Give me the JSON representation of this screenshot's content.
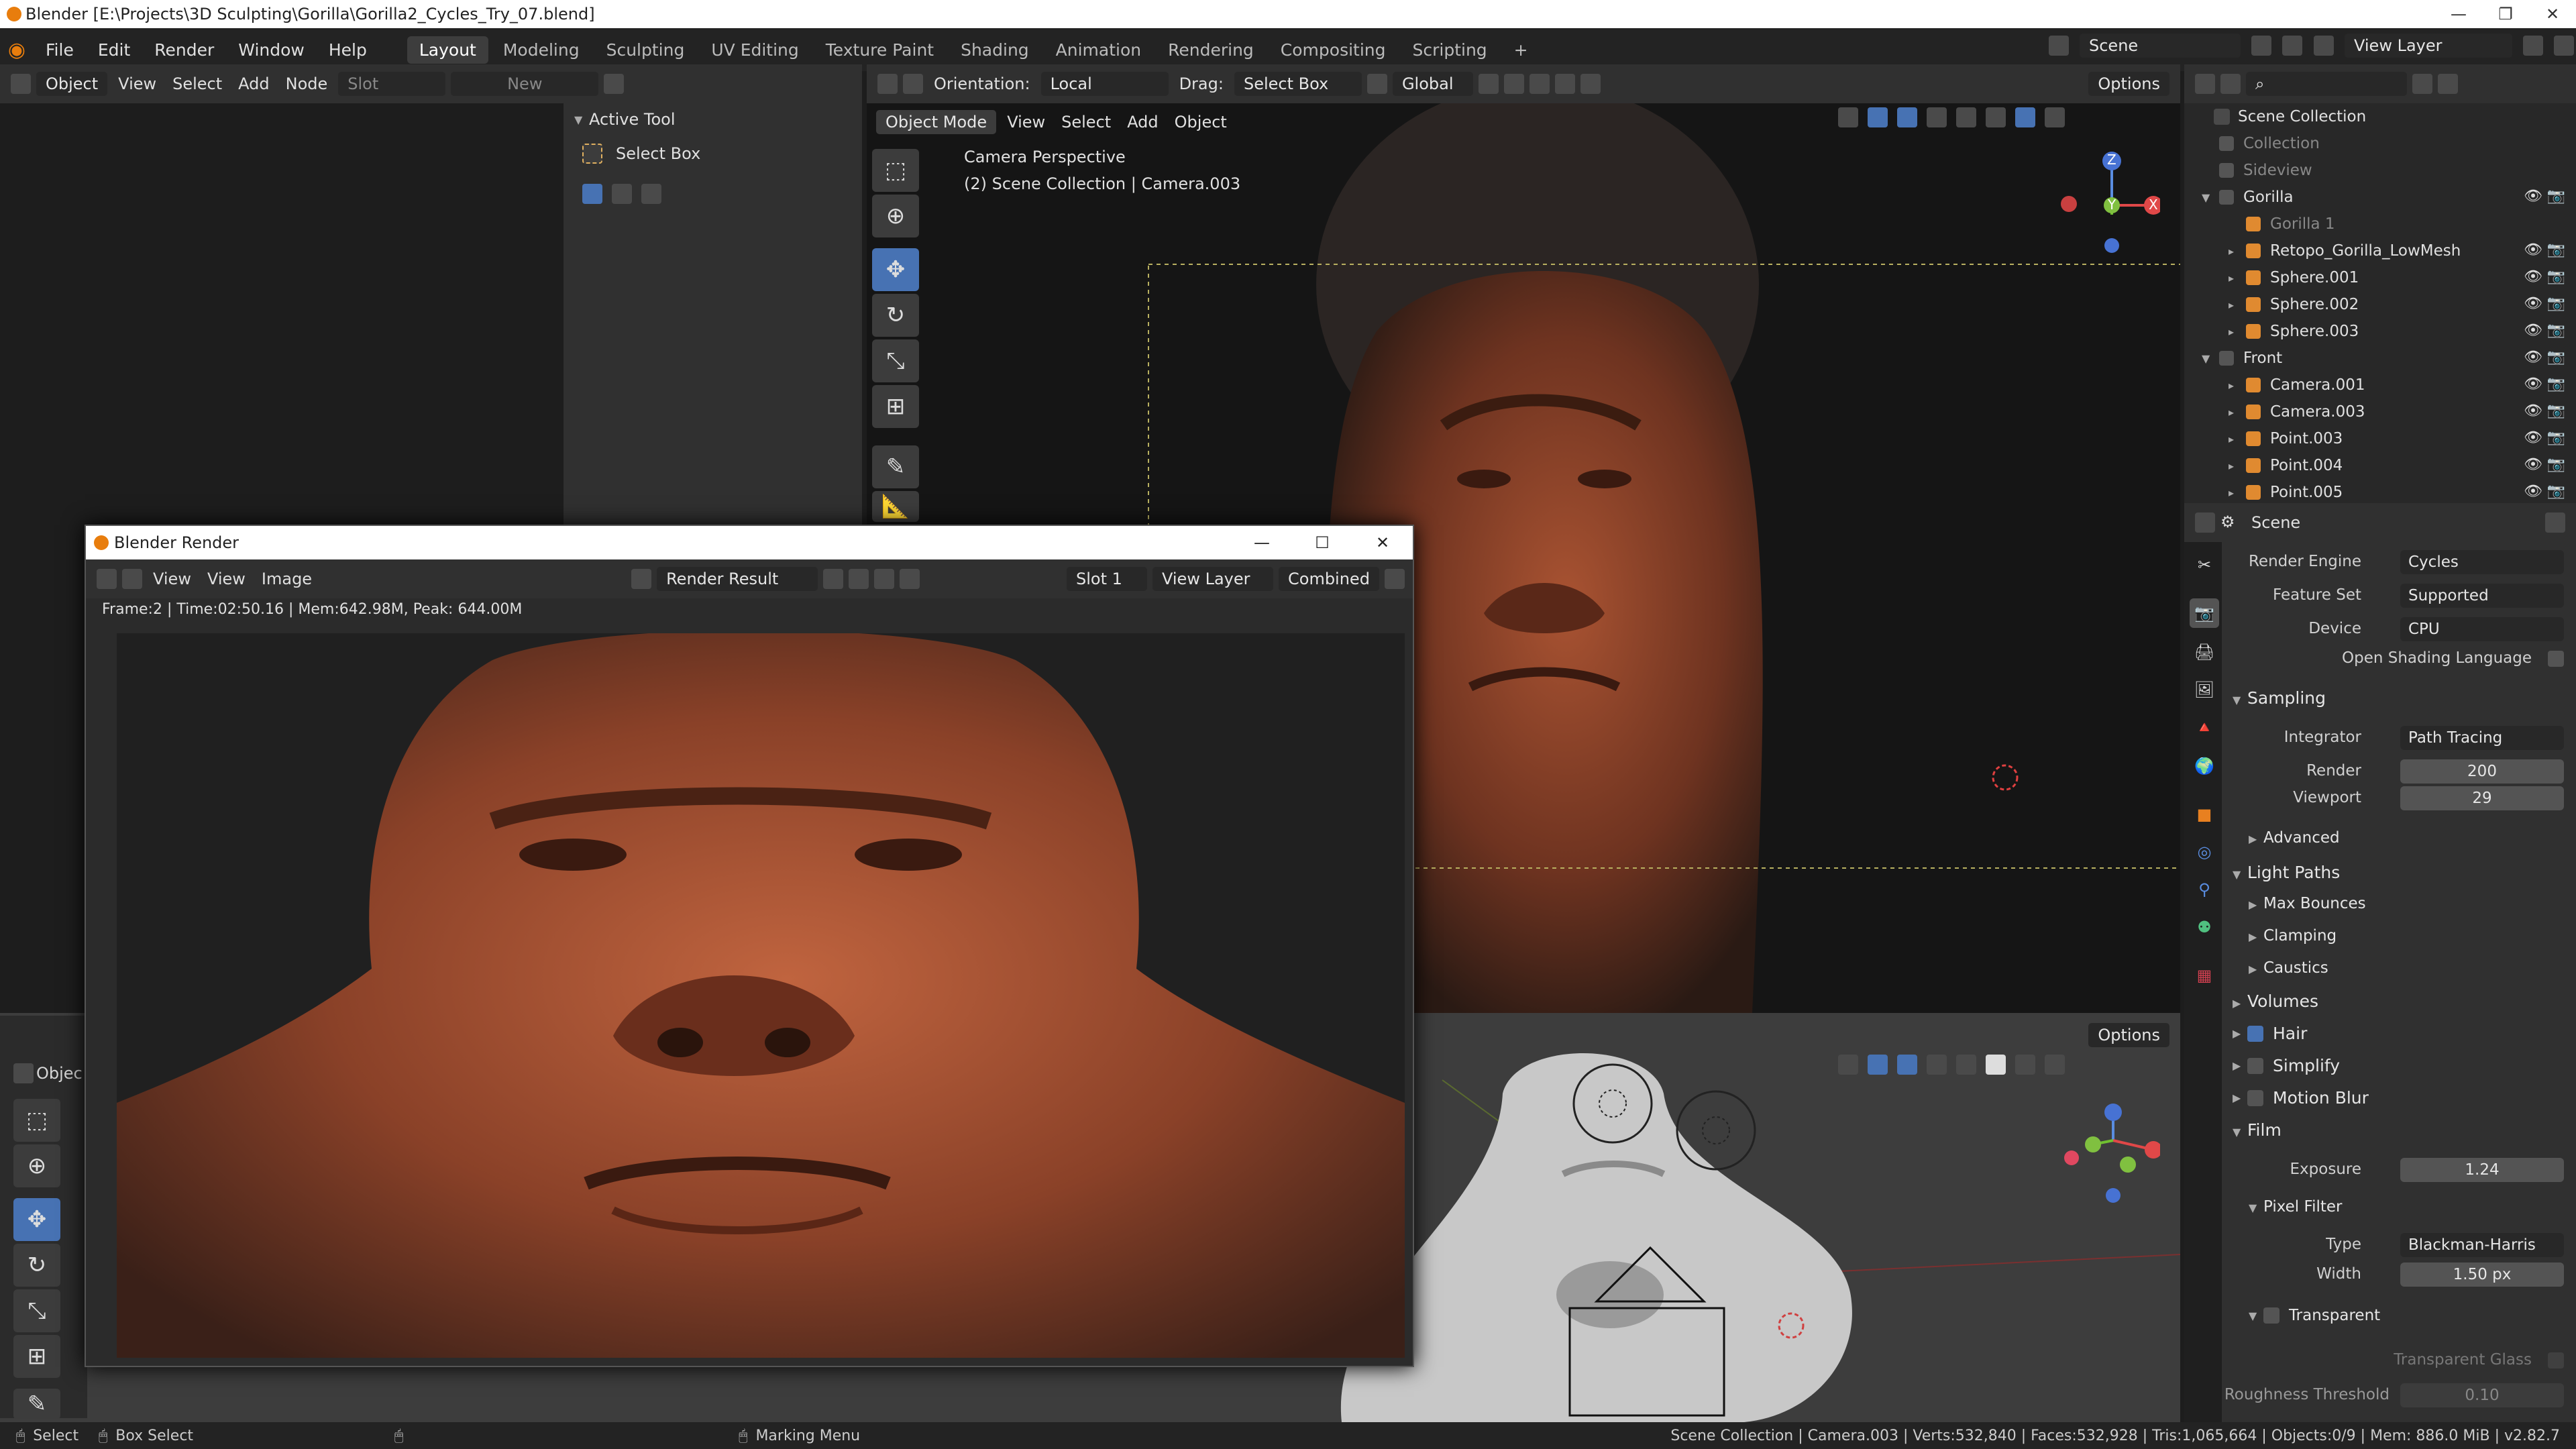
{
  "window": {
    "title": "Blender [E:\\Projects\\3D Sculpting\\Gorilla\\Gorilla2_Cycles_Try_07.blend]"
  },
  "menu": {
    "file": "File",
    "edit": "Edit",
    "render": "Render",
    "window": "Window",
    "help": "Help"
  },
  "workspaces": [
    "Layout",
    "Modeling",
    "Sculpting",
    "UV Editing",
    "Texture Paint",
    "Shading",
    "Animation",
    "Rendering",
    "Compositing",
    "Scripting"
  ],
  "add_workspace": "+",
  "scene": {
    "name": "Scene",
    "view_layer": "View Layer"
  },
  "node_editor": {
    "mode": "Object",
    "view": "View",
    "select": "Select",
    "add": "Add",
    "node": "Node",
    "slot": "Slot",
    "new": "New"
  },
  "active_tool": {
    "title": "Active Tool",
    "name": "Select Box"
  },
  "viewport": {
    "mode": "Object Mode",
    "view": "View",
    "select": "Select",
    "add": "Add",
    "object": "Object",
    "orientation_label": "Orientation:",
    "orientation": "Local",
    "drag_label": "Drag:",
    "drag": "Select Box",
    "transform": "Global",
    "options": "Options",
    "camera_title": "Camera Perspective",
    "camera_sub": "(2) Scene Collection | Camera.003"
  },
  "viewport2": {
    "options": "Options",
    "mode_short": "Objec"
  },
  "render_window": {
    "title": "Blender Render",
    "view1": "View",
    "view2": "View",
    "image": "Image",
    "image_name": "Render Result",
    "slot": "Slot 1",
    "layer": "View Layer",
    "pass": "Combined",
    "stats": "Frame:2 | Time:02:50.16 | Mem:642.98M, Peak: 644.00M"
  },
  "outliner": {
    "root": "Scene Collection",
    "items": [
      {
        "name": "Collection",
        "indent": 0,
        "dim": true,
        "icons": false
      },
      {
        "name": "Sideview",
        "indent": 0,
        "dim": true,
        "icons": false
      },
      {
        "name": "Gorilla",
        "indent": 0,
        "dim": false,
        "icons": true
      },
      {
        "name": "Gorilla 1",
        "indent": 1,
        "dim": true,
        "icons": false
      },
      {
        "name": "Retopo_Gorilla_LowMesh",
        "indent": 1,
        "dim": false,
        "icons": true
      },
      {
        "name": "Sphere.001",
        "indent": 1,
        "dim": false,
        "icons": true
      },
      {
        "name": "Sphere.002",
        "indent": 1,
        "dim": false,
        "icons": true
      },
      {
        "name": "Sphere.003",
        "indent": 1,
        "dim": false,
        "icons": true
      },
      {
        "name": "Front",
        "indent": 0,
        "dim": false,
        "icons": true
      },
      {
        "name": "Camera.001",
        "indent": 1,
        "dim": false,
        "icons": true
      },
      {
        "name": "Camera.003",
        "indent": 1,
        "dim": false,
        "icons": true
      },
      {
        "name": "Point.003",
        "indent": 1,
        "dim": false,
        "icons": true
      },
      {
        "name": "Point.004",
        "indent": 1,
        "dim": false,
        "icons": true
      },
      {
        "name": "Point.005",
        "indent": 1,
        "dim": false,
        "icons": true
      }
    ]
  },
  "properties": {
    "context": "Scene",
    "render_engine_label": "Render Engine",
    "render_engine": "Cycles",
    "feature_set_label": "Feature Set",
    "feature_set": "Supported",
    "device_label": "Device",
    "device": "CPU",
    "osl_label": "Open Shading Language",
    "sampling": "Sampling",
    "integrator_label": "Integrator",
    "integrator": "Path Tracing",
    "render_label": "Render",
    "render_samples": "200",
    "viewport_label": "Viewport",
    "viewport_samples": "29",
    "advanced": "Advanced",
    "light_paths": "Light Paths",
    "max_bounces": "Max Bounces",
    "clamping": "Clamping",
    "caustics": "Caustics",
    "volumes": "Volumes",
    "hair": "Hair",
    "simplify": "Simplify",
    "motion_blur": "Motion Blur",
    "film": "Film",
    "exposure_label": "Exposure",
    "exposure": "1.24",
    "pixel_filter": "Pixel Filter",
    "type_label": "Type",
    "type": "Blackman-Harris",
    "width_label": "Width",
    "width": "1.50 px",
    "transparent": "Transparent",
    "transparent_glass": "Transparent Glass",
    "roughness_label": "Roughness Threshold",
    "roughness": "0.10"
  },
  "status": {
    "select": "Select",
    "box_select": "Box Select",
    "marking_menu": "Marking Menu",
    "info": "Scene Collection | Camera.003 | Verts:532,840 | Faces:532,928 | Tris:1,065,664 | Objects:0/9 | Mem: 886.0 MiB | v2.82.7"
  },
  "gizmo": {
    "x": "X",
    "y": "Y",
    "z": "Z"
  },
  "colors": {
    "accent": "#4772b3",
    "clay": "#b0522f",
    "bg": "#1d1d1d"
  }
}
